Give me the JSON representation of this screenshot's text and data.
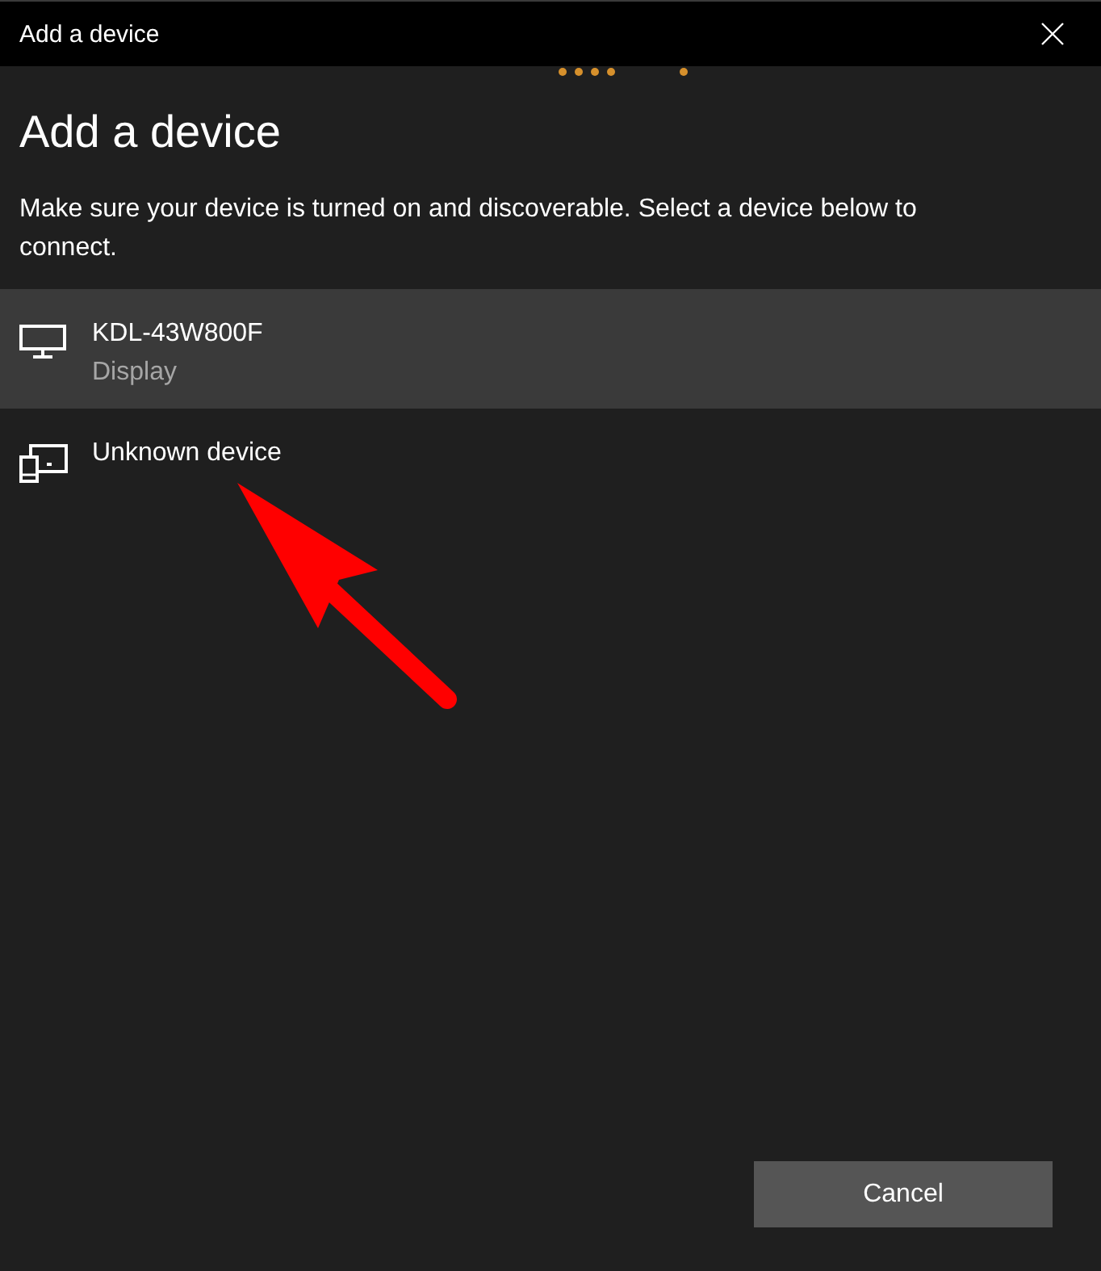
{
  "window": {
    "title": "Add a device"
  },
  "searching": true,
  "heading": "Add a device",
  "instructions": "Make sure your device is turned on and discoverable. Select a device below to connect.",
  "devices": [
    {
      "kind": "display",
      "name": "KDL-43W800F",
      "type": "Display",
      "selected": true
    },
    {
      "kind": "generic",
      "name": "Unknown device",
      "selected": false
    }
  ],
  "buttons": [
    "Cancel"
  ]
}
